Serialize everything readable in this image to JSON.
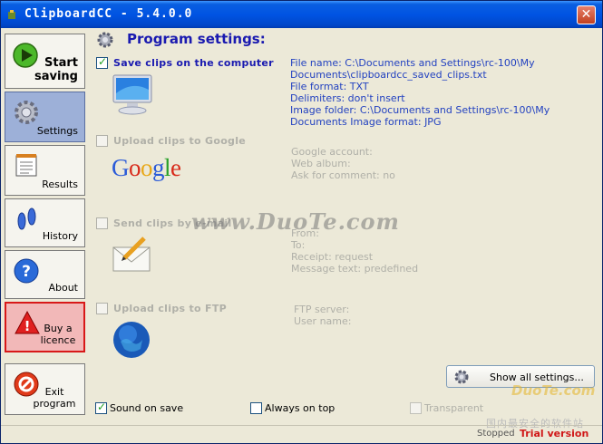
{
  "window": {
    "title": "ClipboardCC - 5.4.0.0",
    "close_label": "✕"
  },
  "sidebar": {
    "items": [
      {
        "label": "Start saving",
        "icon": "play-icon"
      },
      {
        "label": "Settings",
        "icon": "gear-icon"
      },
      {
        "label": "Results",
        "icon": "notepad-icon"
      },
      {
        "label": "History",
        "icon": "footprints-icon"
      },
      {
        "label": "About",
        "icon": "help-icon"
      },
      {
        "label": "Buy a licence",
        "icon": "warning-icon"
      },
      {
        "label": "Exit program",
        "icon": "exit-icon"
      }
    ]
  },
  "main": {
    "title": "Program settings:",
    "sections": [
      {
        "title": "Save clips on the computer",
        "checked": true,
        "icon": "monitor-icon",
        "info": [
          "File name: C:\\Documents and Settings\\rc-100\\My",
          "Documents\\clipboardcc_saved_clips.txt",
          "File format: TXT",
          "Delimiters: don't insert",
          "Image folder: C:\\Documents and Settings\\rc-100\\My",
          "Documents Image format: JPG"
        ]
      },
      {
        "title": "Upload clips to Google",
        "checked": false,
        "icon": "google-logo",
        "logo_text": "Google",
        "info": [
          "Google account:",
          "Web album:",
          "Ask for comment: no"
        ]
      },
      {
        "title": "Send clips by e-mail",
        "checked": false,
        "icon": "envelope-icon",
        "info": [
          "From:",
          "To:",
          "Receipt: request",
          "Message text: predefined"
        ]
      },
      {
        "title": "Upload clips to FTP",
        "checked": false,
        "icon": "globe-icon",
        "info": [
          "FTP server:",
          "User name:"
        ]
      }
    ],
    "show_all_label": "Show all settings..."
  },
  "bottom": {
    "sound_on_save": {
      "label": "Sound on save",
      "checked": true
    },
    "always_on_top": {
      "label": "Always on top",
      "checked": false
    },
    "transparent": {
      "label": "Transparent",
      "checked": false
    }
  },
  "status": {
    "state": "Stopped",
    "license": "Trial version"
  },
  "watermark": {
    "text": "www.DuoTe.com",
    "corner_site": "DuoTe.com",
    "corner_cn": "国内最安全的软件站"
  },
  "colors": {
    "accent": "#1a1ab0",
    "info_on": "#2342c0",
    "trial": "#d01818",
    "titlebar": "#0054e3"
  }
}
